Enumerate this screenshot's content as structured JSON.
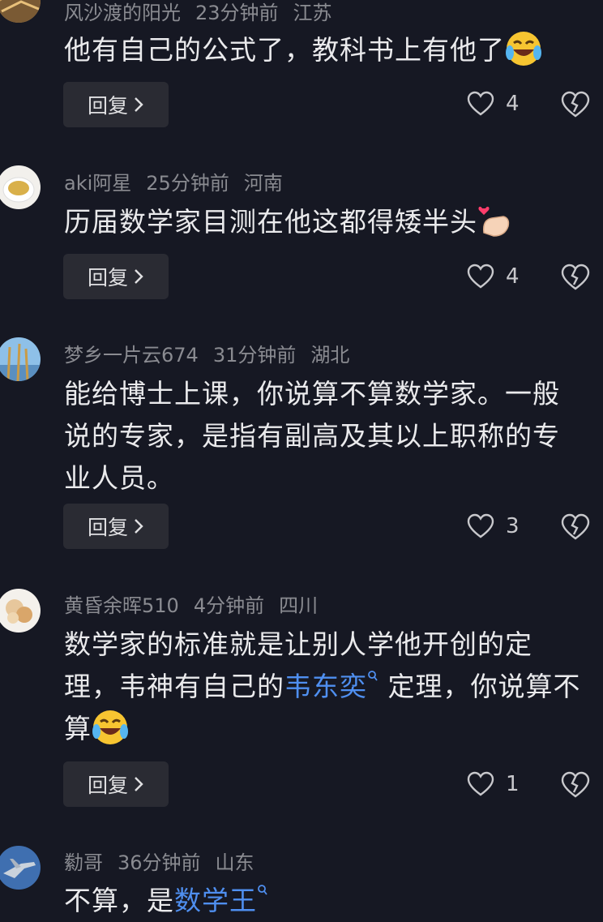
{
  "comments": [
    {
      "user": "风沙渡的阳光",
      "time": "23分钟前",
      "location": "江苏",
      "text_before": "他有自己的公式了，教科书上有他了",
      "link": "",
      "text_after": "",
      "emoji": "laughing-crying-emoji",
      "reply_label": "回复",
      "likes": "4"
    },
    {
      "user": "aki阿星",
      "time": "25分钟前",
      "location": "河南",
      "text_before": "历届数学家目测在他这都得矮半头",
      "link": "",
      "text_after": "",
      "emoji": "finger-heart-emoji",
      "reply_label": "回复",
      "likes": "4"
    },
    {
      "user": "梦乡一片云674",
      "time": "31分钟前",
      "location": "湖北",
      "text_before": "能给博士上课，你说算不算数学家。一般说的专家，是指有副高及其以上职称的专业人员。",
      "link": "",
      "text_after": "",
      "emoji": "",
      "reply_label": "回复",
      "likes": "3"
    },
    {
      "user": "黄昏余晖510",
      "time": "4分钟前",
      "location": "四川",
      "text_before": "数学家的标准就是让别人学他开创的定理，韦神有自己的",
      "link": "韦东奕",
      "text_after": " 定理，你说算不算",
      "emoji": "laughing-crying-emoji",
      "reply_label": "回复",
      "likes": "1"
    },
    {
      "user": "勬哥",
      "time": "36分钟前",
      "location": "山东",
      "text_before": "不算，是",
      "link": "数学王",
      "text_after": "",
      "emoji": "",
      "reply_label": "",
      "likes": ""
    }
  ],
  "colors": {
    "background": "#161823",
    "link": "#4f8ff0",
    "meta": "#8a8b91"
  }
}
